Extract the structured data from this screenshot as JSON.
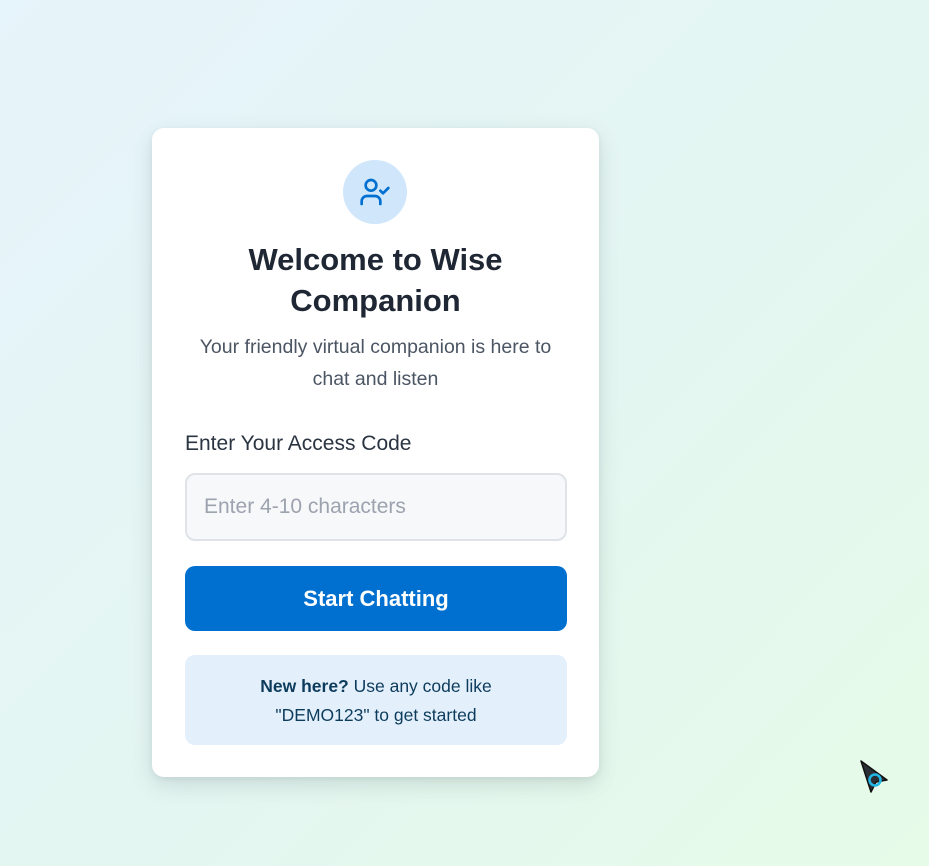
{
  "login": {
    "icon": "user-check-icon",
    "title": "Welcome to Wise Companion",
    "subtitle": "Your friendly virtual companion is here to chat and listen",
    "access_code_label": "Enter Your Access Code",
    "access_code_placeholder": "Enter 4-10 characters",
    "access_code_value": "",
    "submit_label": "Start Chatting",
    "hint_bold": "New here?",
    "hint_text": " Use any code like \"DEMO123\" to get started"
  },
  "colors": {
    "accent": "#0070d0",
    "avatar_bg": "#cfe6fb",
    "hint_bg": "#e3f0fc",
    "title_text": "#1e2733"
  }
}
